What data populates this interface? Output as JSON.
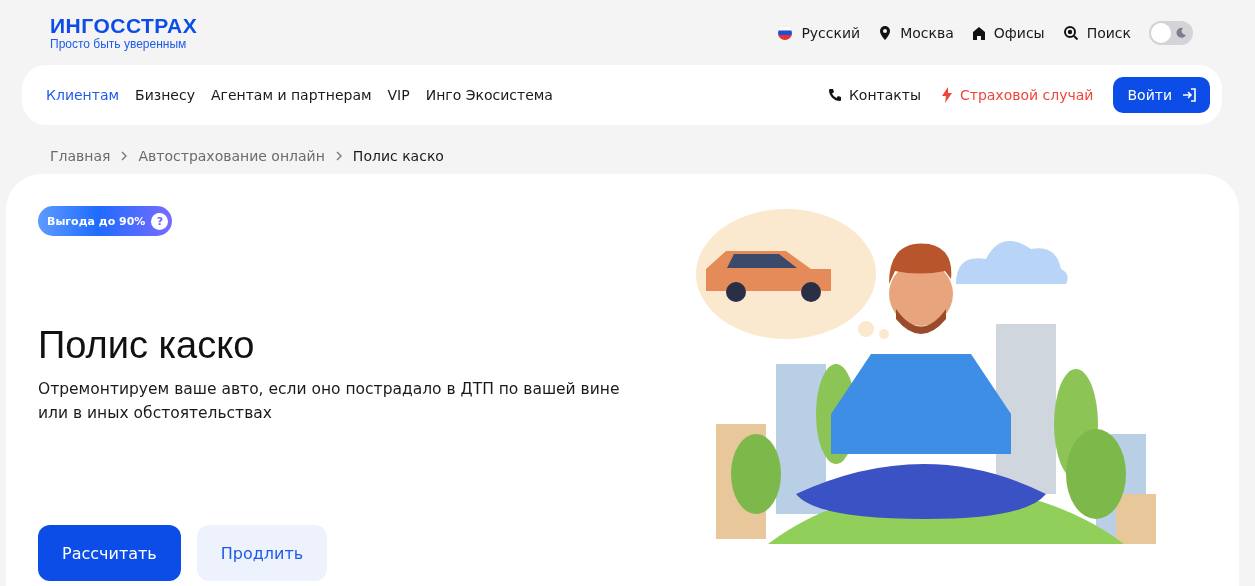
{
  "logo": {
    "name": "ИНГОССТРАХ",
    "tagline": "Просто быть уверенным"
  },
  "top_links": [
    {
      "kind": "flag",
      "label": "Русский"
    },
    {
      "kind": "pin",
      "label": "Москва"
    },
    {
      "kind": "home",
      "label": "Офисы"
    },
    {
      "kind": "search",
      "label": "Поиск"
    }
  ],
  "theme_toggle": {
    "on": false
  },
  "nav": {
    "items": [
      {
        "label": "Клиентам",
        "selected": true
      },
      {
        "label": "Бизнесу",
        "selected": false
      },
      {
        "label": "Агентам и партнерам",
        "selected": false
      },
      {
        "label": "VIP",
        "selected": false
      },
      {
        "label": "Инго Экосистема",
        "selected": false
      }
    ],
    "actions": [
      {
        "kind": "phone",
        "label": "Контакты"
      },
      {
        "kind": "alert",
        "label": "Страховой случай"
      }
    ],
    "login": "Войти"
  },
  "breadcrumbs": [
    {
      "label": "Главная",
      "current": false
    },
    {
      "label": "Автострахование онлайн",
      "current": false
    },
    {
      "label": "Полис каско",
      "current": true
    }
  ],
  "hero": {
    "badge": "Выгода до 90%",
    "badge_icon": "?",
    "title": "Полис каско",
    "subtitle": "Отремонтируем ваше авто, если оно пострадало в ДТП по вашей вине или в иных обстоятельствах",
    "buttons": [
      {
        "label": "Рассчитать",
        "kind": "primary"
      },
      {
        "label": "Продлить",
        "kind": "secondary"
      }
    ]
  }
}
